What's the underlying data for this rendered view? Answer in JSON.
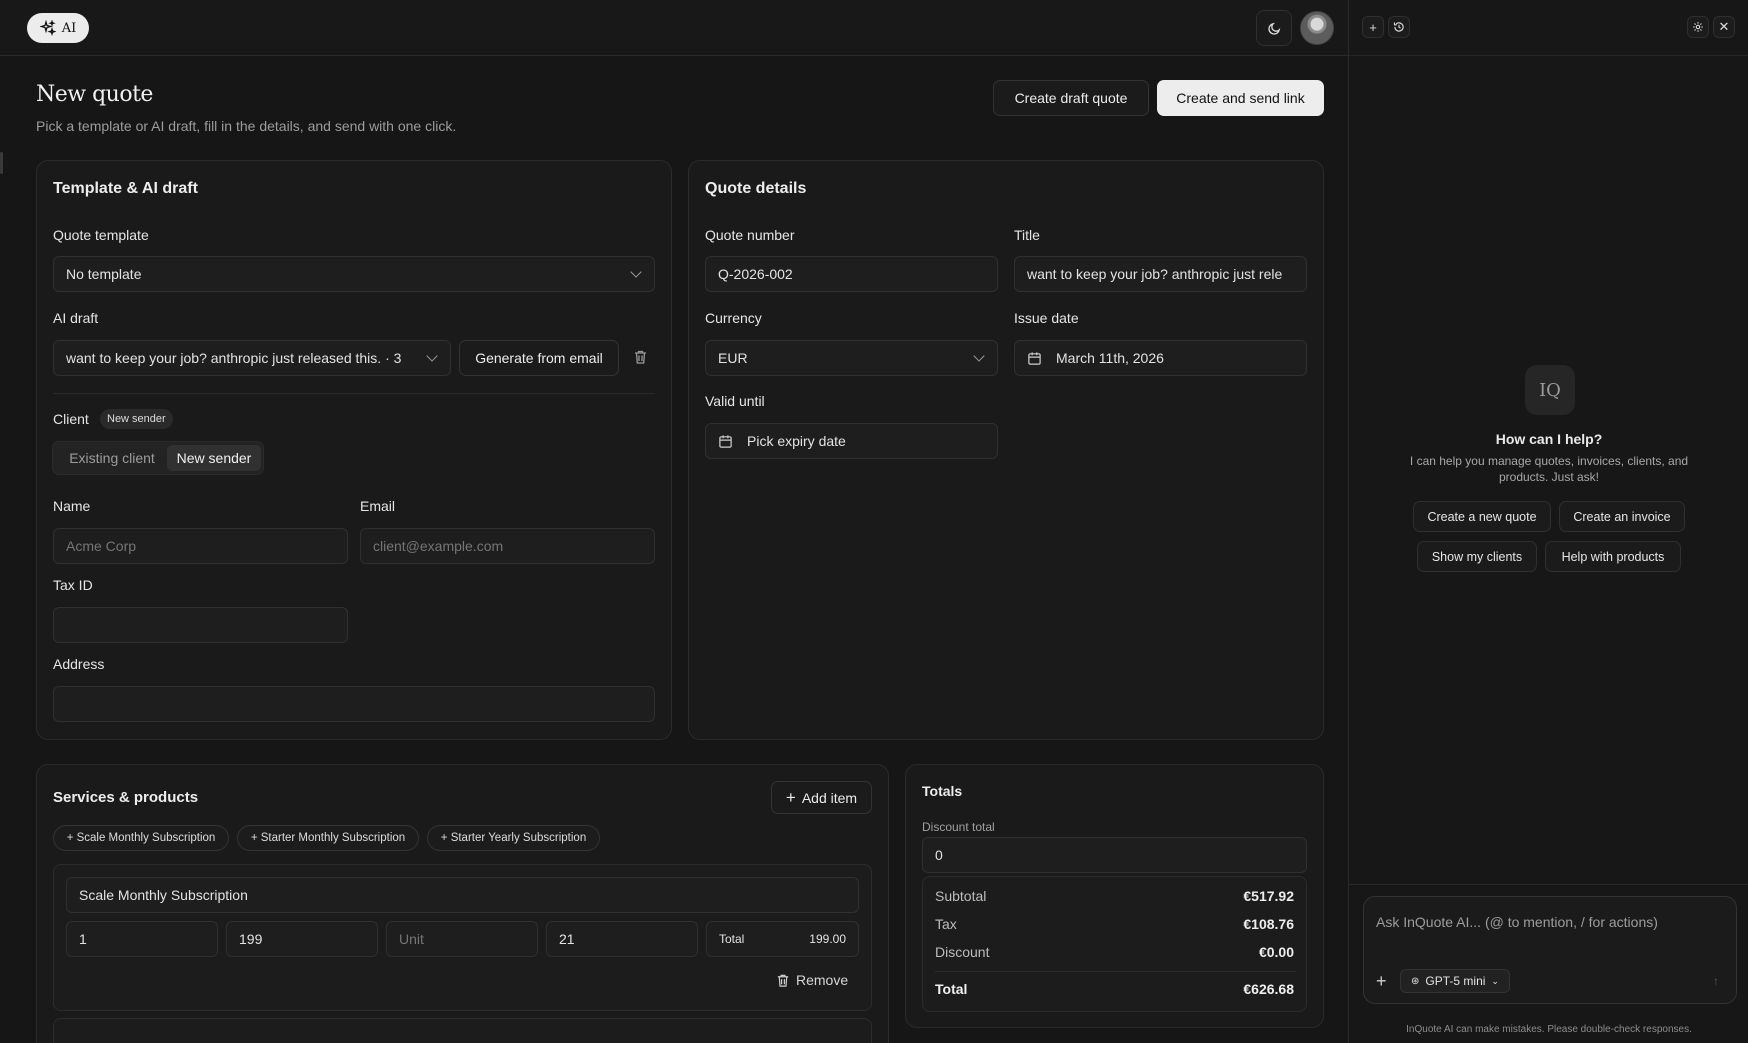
{
  "topbar": {
    "ai_label": "AI"
  },
  "header": {
    "title": "New quote",
    "subtitle": "Pick a template or AI draft, fill in the details, and send with one click.",
    "draft_button": "Create draft quote",
    "send_button": "Create and send link"
  },
  "template_card": {
    "title": "Template & AI draft",
    "template_label": "Quote template",
    "template_value": "No template",
    "ai_draft_label": "AI draft",
    "ai_draft_value": "want to keep your job? anthropic just released this. · 3",
    "generate_button": "Generate from email",
    "client_label": "Client",
    "client_badge": "New sender",
    "seg_existing": "Existing client",
    "seg_new": "New sender",
    "name_label": "Name",
    "name_placeholder": "Acme Corp",
    "email_label": "Email",
    "email_placeholder": "client@example.com",
    "taxid_label": "Tax ID",
    "taxid_value": "",
    "address_label": "Address",
    "address_value": ""
  },
  "details_card": {
    "title": "Quote details",
    "number_label": "Quote number",
    "number_value": "Q-2026-002",
    "title_label": "Title",
    "title_value": "want to keep your job? anthropic just rele",
    "currency_label": "Currency",
    "currency_value": "EUR",
    "issue_label": "Issue date",
    "issue_value": "March 11th, 2026",
    "valid_label": "Valid until",
    "valid_value": "Pick expiry date"
  },
  "services": {
    "title": "Services & products",
    "add_button": "Add item",
    "quick_add": [
      "+ Scale Monthly Subscription",
      "+ Starter Monthly Subscription",
      "+ Starter Yearly Subscription"
    ],
    "item": {
      "name": "Scale Monthly Subscription",
      "qty": "1",
      "price": "199",
      "unit_placeholder": "Unit",
      "tax": "21",
      "total_label": "Total",
      "total_value": "199.00",
      "remove_label": "Remove"
    }
  },
  "totals": {
    "title": "Totals",
    "discount_label": "Discount total",
    "discount_value": "0",
    "rows": [
      {
        "label": "Subtotal",
        "value": "€517.92"
      },
      {
        "label": "Tax",
        "value": "€108.76"
      },
      {
        "label": "Discount",
        "value": "€0.00"
      }
    ],
    "total_label": "Total",
    "total_value": "€626.68"
  },
  "assistant": {
    "logo": "IQ",
    "heading": "How can I help?",
    "subtext": "I can help you manage quotes, invoices, clients, and products. Just ask!",
    "suggestions": [
      "Create a new quote",
      "Create an invoice",
      "Show my clients",
      "Help with products"
    ],
    "input_placeholder": "Ask InQuote AI... (@ to mention, / for actions)",
    "model": "GPT-5 mini",
    "disclaimer": "InQuote AI can make mistakes. Please double-check responses."
  }
}
